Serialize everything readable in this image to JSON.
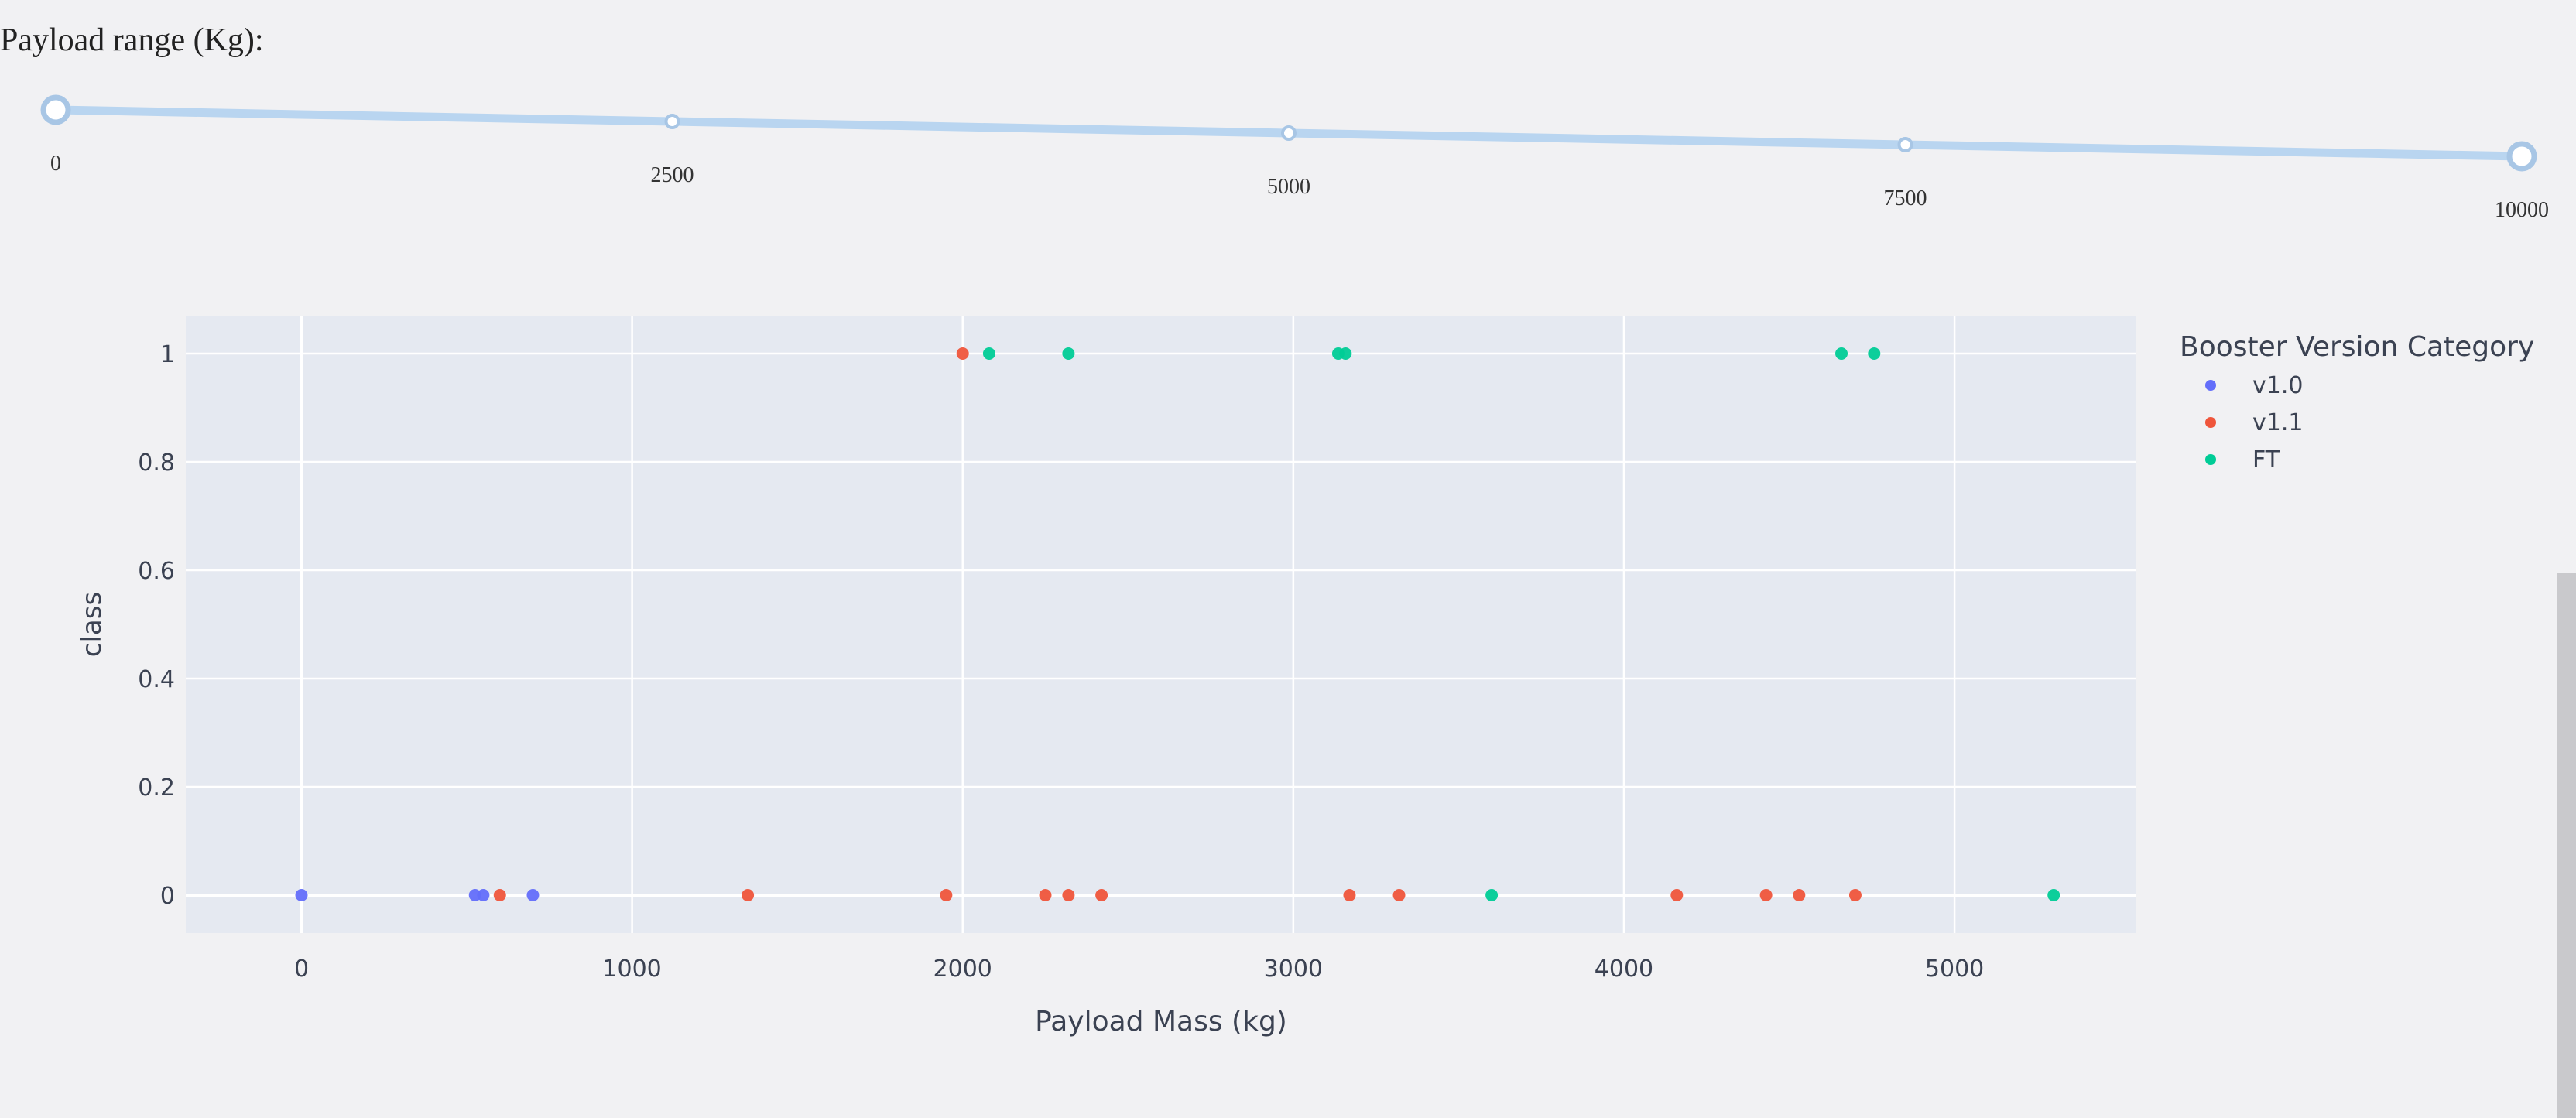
{
  "slider": {
    "label": "Payload range (Kg):",
    "min": 0,
    "max": 10000,
    "value": [
      0,
      10000
    ],
    "marks": [
      "0",
      "2500",
      "5000",
      "7500",
      "10000"
    ],
    "colors": {
      "track": "#b9d5f0",
      "handle": "#ffffff",
      "handle_border": "#a8c6e5"
    }
  },
  "chart_data": {
    "type": "scatter",
    "xlabel": "Payload Mass (kg)",
    "ylabel": "class",
    "xlim": [
      -350,
      5550
    ],
    "ylim": [
      -0.07,
      1.07
    ],
    "x_ticks": [
      0,
      1000,
      2000,
      3000,
      4000,
      5000
    ],
    "y_ticks": [
      0,
      0.2,
      0.4,
      0.6,
      0.8,
      1
    ],
    "y_tick_labels": [
      "0",
      "0.2",
      "0.4",
      "0.6",
      "0.8",
      "1"
    ],
    "grid": true,
    "legend": {
      "title": "Booster Version Category",
      "placement": "right"
    },
    "series": [
      {
        "name": "v1.0",
        "color": "#636efa",
        "points": [
          [
            0,
            0
          ],
          [
            525,
            0
          ],
          [
            550,
            0
          ],
          [
            700,
            0
          ]
        ]
      },
      {
        "name": "v1.1",
        "color": "#ef553b",
        "points": [
          [
            600,
            0
          ],
          [
            1350,
            0
          ],
          [
            1950,
            0
          ],
          [
            2000,
            1
          ],
          [
            2250,
            0
          ],
          [
            2320,
            0
          ],
          [
            2420,
            0
          ],
          [
            3170,
            0
          ],
          [
            3320,
            0
          ],
          [
            4160,
            0
          ],
          [
            4430,
            0
          ],
          [
            4530,
            0
          ],
          [
            4700,
            0
          ]
        ]
      },
      {
        "name": "FT",
        "color": "#00cc96",
        "points": [
          [
            2080,
            1
          ],
          [
            2320,
            1
          ],
          [
            3136,
            1
          ],
          [
            3158,
            1
          ],
          [
            3600,
            0
          ],
          [
            4658,
            1
          ],
          [
            4757,
            1
          ],
          [
            5300,
            0
          ]
        ]
      }
    ]
  }
}
